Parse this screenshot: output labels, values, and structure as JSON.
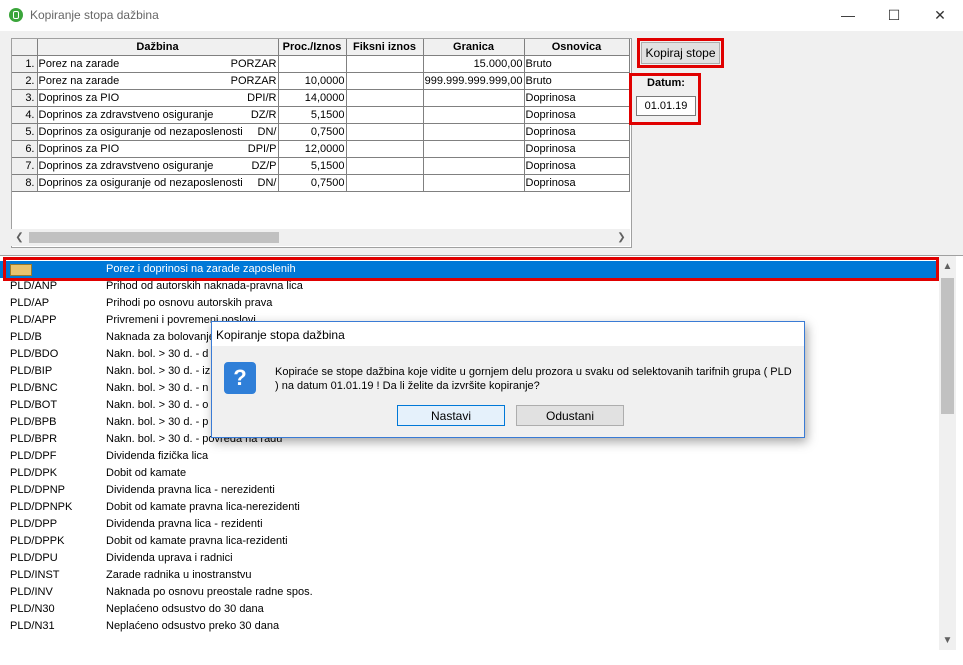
{
  "window": {
    "title": "Kopiranje stopa dažbina",
    "minimize": "—",
    "maximize": "☐",
    "close": "✕"
  },
  "grid": {
    "headers": [
      "",
      "Dažbina",
      "Proc./Iznos",
      "Fiksni iznos",
      "Granica",
      "Osnovica"
    ],
    "rows": [
      {
        "n": "1.",
        "name": "Porez na zarade",
        "code": "PORZAR",
        "proc": "",
        "fix": "",
        "gran": "15.000,00",
        "osn": "Bruto"
      },
      {
        "n": "2.",
        "name": "Porez na zarade",
        "code": "PORZAR",
        "proc": "10,0000",
        "fix": "",
        "gran": "999.999.999.999,00",
        "osn": "Bruto"
      },
      {
        "n": "3.",
        "name": "Doprinos za PIO",
        "code": "DPI/R",
        "proc": "14,0000",
        "fix": "",
        "gran": "",
        "osn": "Doprinosa"
      },
      {
        "n": "4.",
        "name": "Doprinos za zdravstveno osiguranje",
        "code": "DZ/R",
        "proc": "5,1500",
        "fix": "",
        "gran": "",
        "osn": "Doprinosa"
      },
      {
        "n": "5.",
        "name": "Doprinos za osiguranje od nezaposlenosti",
        "code": "DN/",
        "proc": "0,7500",
        "fix": "",
        "gran": "",
        "osn": "Doprinosa"
      },
      {
        "n": "6.",
        "name": "Doprinos za PIO",
        "code": "DPI/P",
        "proc": "12,0000",
        "fix": "",
        "gran": "",
        "osn": "Doprinosa"
      },
      {
        "n": "7.",
        "name": "Doprinos za zdravstveno osiguranje",
        "code": "DZ/P",
        "proc": "5,1500",
        "fix": "",
        "gran": "",
        "osn": "Doprinosa"
      },
      {
        "n": "8.",
        "name": "Doprinos za osiguranje od nezaposlenosti",
        "code": "DN/",
        "proc": "0,7500",
        "fix": "",
        "gran": "",
        "osn": "Doprinosa"
      }
    ]
  },
  "copy_button": "Kopiraj stope",
  "date": {
    "label": "Datum:",
    "value": "01.01.19"
  },
  "list": [
    {
      "code": "",
      "name": "Porez i doprinosi na zarade zaposlenih",
      "selected": true
    },
    {
      "code": "PLD/ANP",
      "name": "Prihod od autorskih naknada-pravna lica"
    },
    {
      "code": "PLD/AP",
      "name": "Prihodi po osnovu autorskih prava"
    },
    {
      "code": "PLD/APP",
      "name": "Privremeni i povremeni poslovi"
    },
    {
      "code": "PLD/B",
      "name": "Naknada za bolovanje"
    },
    {
      "code": "PLD/BDO",
      "name": "Nakn. bol. > 30 d. - d"
    },
    {
      "code": "PLD/BIP",
      "name": "Nakn. bol. > 30 d. - iz"
    },
    {
      "code": "PLD/BNC",
      "name": "Nakn. bol. > 30 d. - n"
    },
    {
      "code": "PLD/BOT",
      "name": "Nakn. bol. > 30 d. - o"
    },
    {
      "code": "PLD/BPB",
      "name": "Nakn. bol. > 30 d. - p"
    },
    {
      "code": "PLD/BPR",
      "name": "Nakn. bol. > 30 d. - povreda na radu"
    },
    {
      "code": "PLD/DPF",
      "name": "Dividenda fizička lica"
    },
    {
      "code": "PLD/DPK",
      "name": "Dobit od kamate"
    },
    {
      "code": "PLD/DPNP",
      "name": "Dividenda pravna lica - nerezidenti"
    },
    {
      "code": "PLD/DPNPK",
      "name": "Dobit od kamate pravna lica-nerezidenti"
    },
    {
      "code": "PLD/DPP",
      "name": "Dividenda pravna lica - rezidenti"
    },
    {
      "code": "PLD/DPPK",
      "name": "Dobit od kamate pravna lica-rezidenti"
    },
    {
      "code": "PLD/DPU",
      "name": "Dividenda uprava i radnici"
    },
    {
      "code": "PLD/INST",
      "name": "Zarade radnika u inostranstvu"
    },
    {
      "code": "PLD/INV",
      "name": "Naknada po osnovu preostale radne spos."
    },
    {
      "code": "PLD/N30",
      "name": "Neplaćeno odsustvo do 30 dana"
    },
    {
      "code": "PLD/N31",
      "name": "Neplaćeno odsustvo preko 30 dana"
    }
  ],
  "dialog": {
    "title": "Kopiranje stopa dažbina",
    "message": "Kopiraće se stope dažbina koje vidite u gornjem delu prozora u svaku od selektovanih tarifnih grupa ( PLD ) na datum 01.01.19 ! Da li želite da izvršite kopiranje?",
    "ok": "Nastavi",
    "cancel": "Odustani"
  },
  "colors": {
    "highlight": "#e00000",
    "selection": "#0078d7",
    "icon_green": "#3aa53a",
    "question_icon": "#2f7fd8"
  }
}
